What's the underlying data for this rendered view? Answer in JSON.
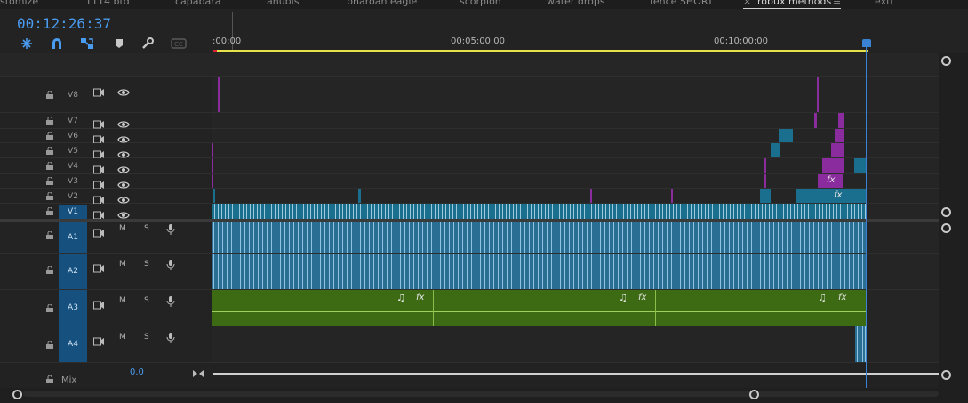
{
  "tabs": [
    {
      "label": "stomize",
      "active": false
    },
    {
      "label": "1114 btd",
      "active": false
    },
    {
      "label": "capabara",
      "active": false
    },
    {
      "label": "anubis",
      "active": false
    },
    {
      "label": "pharoah eagle",
      "active": false
    },
    {
      "label": "scorpion",
      "active": false
    },
    {
      "label": "water drops",
      "active": false
    },
    {
      "label": "fence SHORT",
      "active": false
    },
    {
      "label": "robux methods",
      "active": true
    },
    {
      "label": "extr",
      "active": false
    }
  ],
  "tab_close": "×",
  "tab_menu": "≡",
  "timecode": "00:12:26:37",
  "toolbar": [
    {
      "name": "insert-sequence-as-nest-icon"
    },
    {
      "name": "snap-icon"
    },
    {
      "name": "linked-selection-icon"
    },
    {
      "name": "add-marker-icon"
    },
    {
      "name": "timeline-settings-wrench-icon"
    },
    {
      "name": "captions-icon"
    }
  ],
  "ruler": {
    "labels": [
      ":00:00",
      "00:05:00:00",
      "00:10:00:00"
    ]
  },
  "video_tracks": [
    {
      "name": "V8"
    },
    {
      "name": "V7"
    },
    {
      "name": "V6"
    },
    {
      "name": "V5"
    },
    {
      "name": "V4"
    },
    {
      "name": "V3"
    },
    {
      "name": "V2"
    },
    {
      "name": "V1",
      "selected": true
    }
  ],
  "audio_tracks": [
    {
      "name": "A1",
      "m": "M",
      "s": "S"
    },
    {
      "name": "A2",
      "m": "M",
      "s": "S"
    },
    {
      "name": "A3",
      "m": "M",
      "s": "S"
    },
    {
      "name": "A4",
      "m": "M",
      "s": "S"
    }
  ],
  "audio_clip_labels": {
    "note": "♫",
    "fx": "fx"
  },
  "video_fx_label": "fx",
  "mix": {
    "label": "Mix",
    "value": "0.0"
  },
  "colors": {
    "accent": "#3a82d4",
    "timecode": "#4a9cf0",
    "video_clip": "#1a6e8e",
    "video_clip_purple": "#8a2b9e",
    "audio_clip_blue": "#2a6e94",
    "audio_clip_green": "#3d6b14",
    "work_area": "#e8e24a"
  }
}
